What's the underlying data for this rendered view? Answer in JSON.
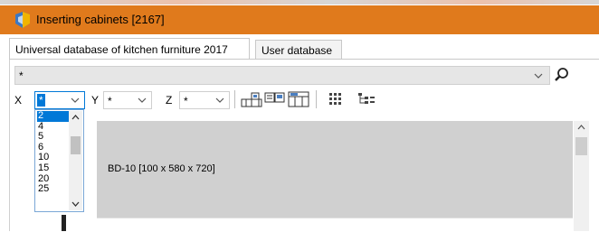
{
  "window": {
    "title": "Inserting cabinets [2167]",
    "accent_color": "#e07a1c",
    "icon": "app-logo-icon"
  },
  "tabs": [
    {
      "label": "Universal database of kitchen furniture 2017",
      "active": true
    },
    {
      "label": "User database",
      "active": false
    }
  ],
  "filter": {
    "database_value": "*",
    "search_icon": "magnifier-icon"
  },
  "dimensions": {
    "x": {
      "label": "X",
      "value": "*"
    },
    "y": {
      "label": "Y",
      "value": "*"
    },
    "z": {
      "label": "Z",
      "value": "*"
    }
  },
  "toolbar": {
    "icons": [
      "view-layout-1-icon",
      "view-layout-2-icon",
      "view-layout-3-icon",
      "grid-view-icon",
      "tree-view-icon"
    ]
  },
  "x_dropdown": {
    "options": [
      "2",
      "4",
      "5",
      "6",
      "10",
      "15",
      "20",
      "25"
    ],
    "selected_index": 0
  },
  "cabinets": [
    {
      "label": "BD-10  [100 x 580 x 720]",
      "color": "#d0d0d0"
    }
  ]
}
